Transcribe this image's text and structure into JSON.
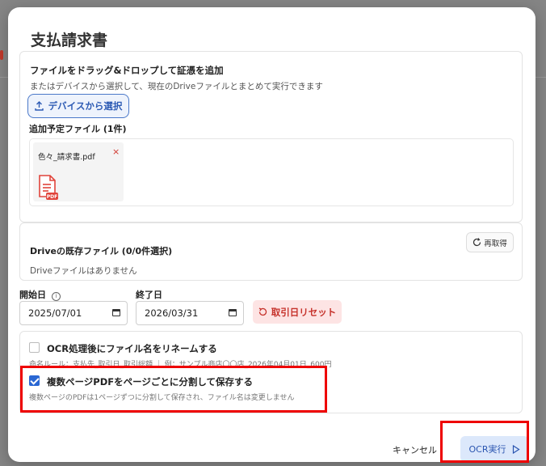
{
  "modal": {
    "title": "支払請求書"
  },
  "upload": {
    "heading": "ファイルをドラッグ&ドロップして証憑を追加",
    "subtext": "またはデバイスから選択して、現在のDriveファイルとまとめて実行できます",
    "device_button": "デバイスから選択",
    "pending_label": "追加予定ファイル (1件)",
    "files": [
      {
        "name": "色々_請求書.pdf",
        "icon": "pdf-file-icon",
        "remove_symbol": "×"
      }
    ]
  },
  "drive": {
    "heading": "Driveの既存ファイル (0/0件選択)",
    "empty_text": "Driveファイルはありません",
    "refresh_button": "再取得"
  },
  "dates": {
    "start_label": "開始日",
    "start_value": "2025/07/01",
    "end_label": "終了日",
    "end_value": "2026/03/31",
    "reset_button": "取引日リセット"
  },
  "options": {
    "rename": {
      "label": "OCR処理後にファイル名をリネームする",
      "description": "命名ルール：支払先_取引日_取引総額 ｜ 例：サンプル商店〇〇店_2026年04月01日_600円",
      "checked": false
    },
    "split": {
      "label": "複数ページPDFをページごとに分割して保存する",
      "description": "複数ページのPDFは1ページずつに分割して保存され、ファイル名は変更しません",
      "checked": true
    }
  },
  "footer": {
    "cancel_button": "キャンセル",
    "ocr_button": "OCR実行"
  },
  "colors": {
    "accent": "#2a67d3",
    "danger": "#d0342c",
    "highlight": "#ee0000"
  }
}
